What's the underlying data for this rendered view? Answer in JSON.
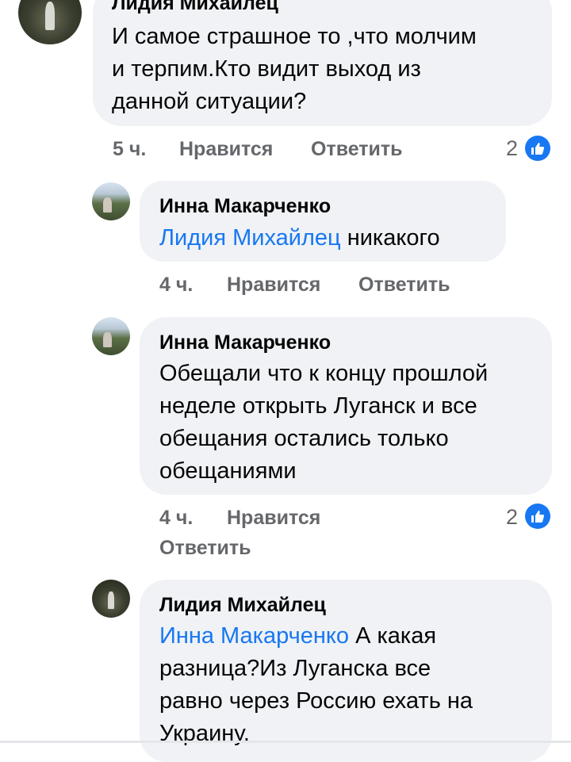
{
  "comments": [
    {
      "author": "Лидия Михайлец",
      "lines": [
        "И самое страшное то ,что молчим",
        "и терпим.Кто видит выход из",
        "данной ситуации?"
      ],
      "time": "5 ч.",
      "like_label": "Нравится",
      "reply_label": "Ответить",
      "reactions": "2"
    },
    {
      "author": "Инна Макарченко",
      "mention": "Лидия Михайлец",
      "text": " никакого",
      "time": "4 ч.",
      "like_label": "Нравится",
      "reply_label": "Ответить"
    },
    {
      "author": "Инна Макарченко",
      "lines": [
        "Обещали что к концу прошлой",
        "неделе открыть Луганск и все",
        "обещания остались только",
        "обещаниями"
      ],
      "time": "4 ч.",
      "like_label": "Нравится",
      "reply_label": "Ответить",
      "reactions": "2"
    },
    {
      "author": "Лидия Михайлец",
      "mention": "Инна Макарченко",
      "text_first": " А какая",
      "lines": [
        "разница?Из Луганска все",
        "равно через Россию ехать на",
        "Украину."
      ]
    }
  ],
  "colors": {
    "accent": "#1877f2",
    "bubble": "#f0f2f5",
    "meta": "#65676b"
  },
  "icons": {
    "reaction": "thumbs-up-icon"
  }
}
